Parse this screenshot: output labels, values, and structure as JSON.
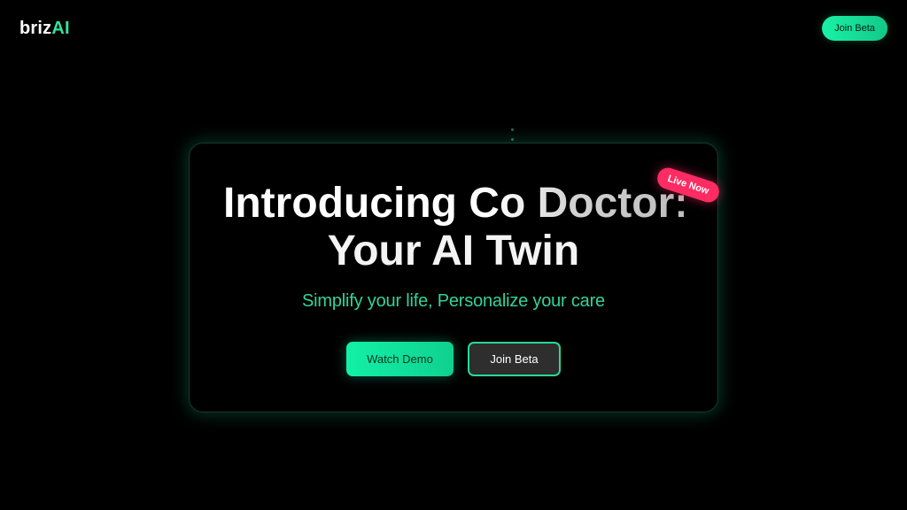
{
  "header": {
    "logo_primary": "briz",
    "logo_accent": "AI",
    "join_beta_label": "Join Beta"
  },
  "hero": {
    "badge": "Live Now",
    "title_line_1": "Introducing Co Doctor:",
    "title_line_2": "Your AI Twin",
    "subtitle": "Simplify your life, Personalize your care",
    "watch_demo_label": "Watch Demo",
    "join_beta_label": "Join Beta"
  },
  "colors": {
    "background": "#000000",
    "accent_green": "#12f0a6",
    "subtitle_green": "#33d39a",
    "badge_pink": "#ff2b63",
    "button_dark": "#2e2e2e"
  }
}
